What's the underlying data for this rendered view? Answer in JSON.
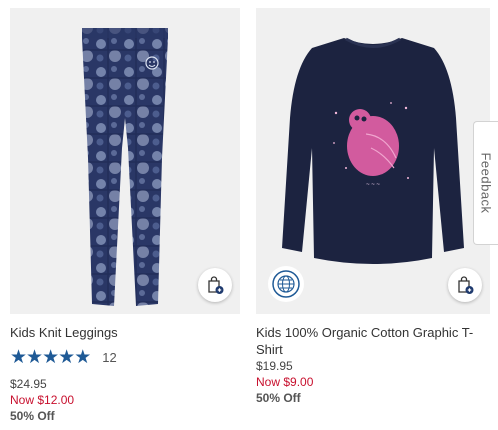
{
  "colors": {
    "accent": "#1f5a96",
    "sale": "#c8102e",
    "image_bg": "#f0f0f0"
  },
  "products": [
    {
      "name": "Kids Knit Leggings",
      "rating": 5,
      "review_count": "12",
      "price": "$24.95",
      "sale_price": "Now $12.00",
      "discount": "50% Off",
      "icons": [
        "quick-add-bag-icon"
      ]
    },
    {
      "name": "Kids 100% Organic Cotton Graphic T-Shirt",
      "price": "$19.95",
      "sale_price": "Now $9.00",
      "discount": "50% Off",
      "icons": [
        "sustainability-globe-icon",
        "quick-add-bag-icon"
      ]
    }
  ],
  "feedback": {
    "label": "Feedback"
  }
}
